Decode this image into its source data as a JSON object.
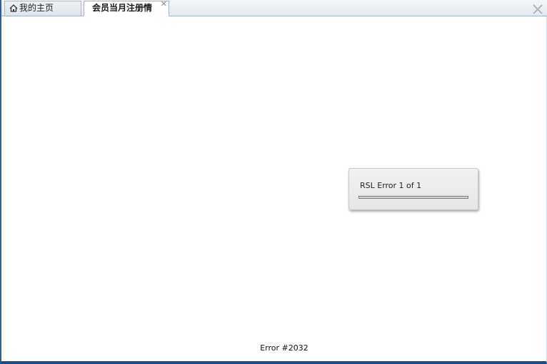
{
  "tabs": [
    {
      "label": "我的主页",
      "icon": "home-icon"
    },
    {
      "label": "会员当月注册情",
      "close_glyph": "✕"
    }
  ],
  "dialog": {
    "message": "RSL Error 1 of 1",
    "progress": 0
  },
  "footer": {
    "error_code": "Error #2032"
  },
  "colors": {
    "frame_border": "#2f5f98",
    "bottom_bar": "#1a4e8a"
  }
}
